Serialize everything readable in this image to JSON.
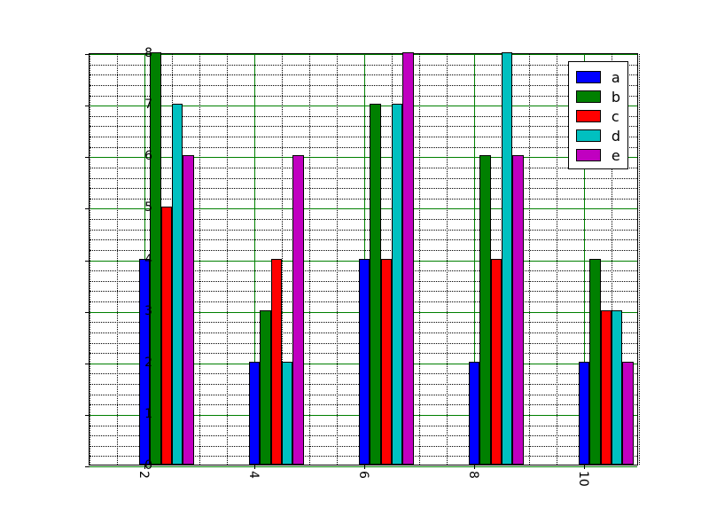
{
  "chart_data": {
    "type": "bar",
    "categories": [
      2,
      4,
      6,
      8,
      10
    ],
    "series": [
      {
        "name": "a",
        "color": "#0000ff",
        "values": [
          4,
          2,
          4,
          2,
          2
        ]
      },
      {
        "name": "b",
        "color": "#008000",
        "values": [
          8,
          3,
          7,
          6,
          4
        ]
      },
      {
        "name": "c",
        "color": "#ff0000",
        "values": [
          5,
          4,
          4,
          4,
          3
        ]
      },
      {
        "name": "d",
        "color": "#00c0c0",
        "values": [
          7,
          2,
          7,
          8,
          3
        ]
      },
      {
        "name": "e",
        "color": "#c000c0",
        "values": [
          6,
          6,
          8,
          6,
          2
        ]
      }
    ],
    "ylim": [
      0,
      8
    ],
    "xlim": [
      1,
      11
    ],
    "y_major_ticks": [
      0,
      1,
      2,
      3,
      4,
      5,
      6,
      7,
      8
    ],
    "y_minor_step": 0.2,
    "x_major_ticks": [
      2,
      4,
      6,
      8,
      10
    ],
    "x_minor_step": 0.5,
    "bar_width": 0.2,
    "title": "",
    "xlabel": "",
    "ylabel": "",
    "legend_position": "upper right",
    "grid": {
      "major_color": "#008000",
      "minor_style": "dotted"
    }
  }
}
